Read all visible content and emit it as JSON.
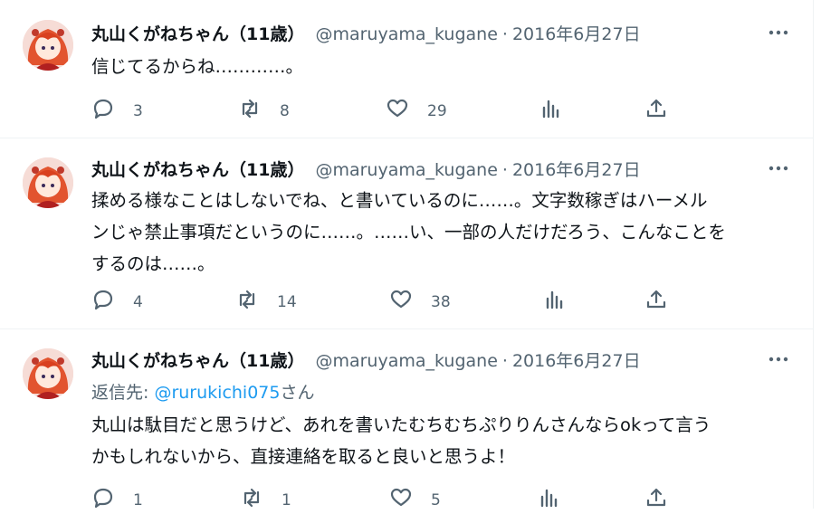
{
  "tweets": [
    {
      "author_name": "丸山くがねちゃん（11歳）",
      "handle": "@maruyama_kugane",
      "separator": "·",
      "date": "2016年6月27日",
      "text": "信じてるからね…………。",
      "stats": {
        "replies": "3",
        "retweets": "8",
        "likes": "29"
      }
    },
    {
      "author_name": "丸山くがねちゃん（11歳）",
      "handle": "@maruyama_kugane",
      "separator": "·",
      "date": "2016年6月27日",
      "text_lines": [
        "揉める様なことはしないでね、と書いているのに……。文字数稼ぎはハーメル",
        "ンじゃ禁止事項だというのに……。……い、一部の人だけだろう、こんなことを",
        "するのは……。"
      ],
      "stats": {
        "replies": "4",
        "retweets": "14",
        "likes": "38"
      }
    },
    {
      "author_name": "丸山くがねちゃん（11歳）",
      "handle": "@maruyama_kugane",
      "separator": "·",
      "date": "2016年6月27日",
      "reply_prefix": "返信先: ",
      "reply_to": "@rurukichi075",
      "reply_suffix": "さん",
      "text_lines": [
        "丸山は駄目だと思うけど、あれを書いたむちむちぷりりんさんならokって言う",
        "かもしれないから、直接連絡を取ると良いと思うよ！"
      ],
      "stats": {
        "replies": "1",
        "retweets": "1",
        "likes": "5"
      }
    }
  ],
  "icons": {
    "reply": "reply-bubble-icon",
    "retweet": "retweet-icon",
    "like": "heart-icon",
    "views": "bar-chart-icon",
    "share": "share-upload-icon",
    "more": "more-dots-icon"
  },
  "colors": {
    "text": "#0f1419",
    "secondary": "#536471",
    "link": "#1d9bf0",
    "divider": "#eff3f4"
  }
}
